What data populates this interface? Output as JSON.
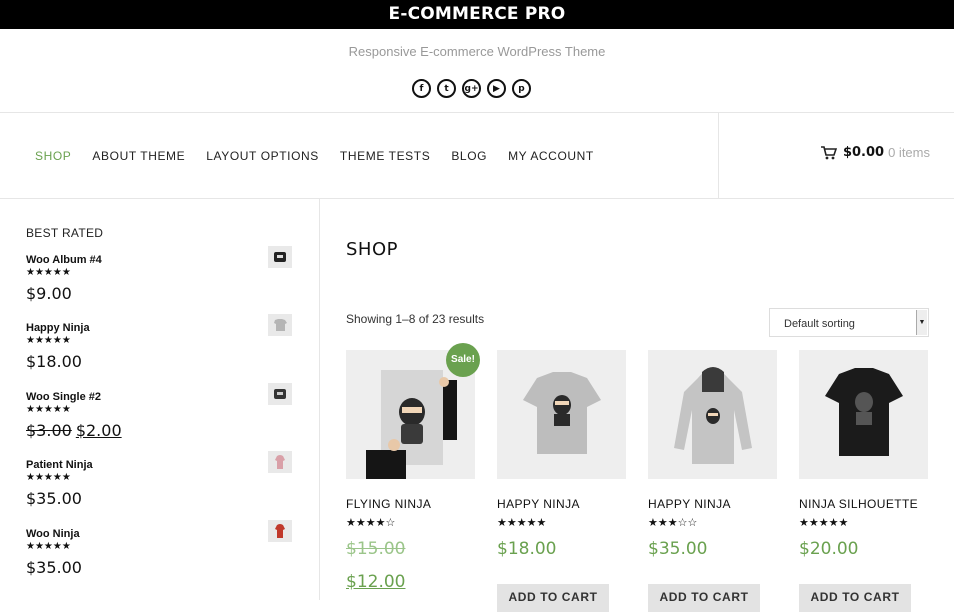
{
  "header": {
    "title": "E-COMMERCE PRO",
    "tagline": "Responsive E-commerce WordPress Theme",
    "socials": [
      {
        "name": "facebook-icon",
        "glyph": "f"
      },
      {
        "name": "twitter-icon",
        "glyph": "t"
      },
      {
        "name": "google-plus-icon",
        "glyph": "g+"
      },
      {
        "name": "youtube-icon",
        "glyph": "▶"
      },
      {
        "name": "pinterest-icon",
        "glyph": "p"
      }
    ]
  },
  "nav": {
    "items": [
      "SHOP",
      "ABOUT THEME",
      "LAYOUT OPTIONS",
      "THEME TESTS",
      "BLOG",
      "MY ACCOUNT"
    ],
    "active": "SHOP"
  },
  "cart": {
    "amount": "$0.00",
    "items": "0 items"
  },
  "sidebar": {
    "title": "BEST RATED",
    "items": [
      {
        "name": "Woo Album #4",
        "stars": "★★★★★",
        "price": "$9.00"
      },
      {
        "name": "Happy Ninja",
        "stars": "★★★★★",
        "price": "$18.00"
      },
      {
        "name": "Woo Single #2",
        "stars": "★★★★★",
        "old_price": "$3.00",
        "new_price": "$2.00"
      },
      {
        "name": "Patient Ninja",
        "stars": "★★★★★",
        "price": "$35.00"
      },
      {
        "name": "Woo Ninja",
        "stars": "★★★★★",
        "price": "$35.00"
      }
    ]
  },
  "main": {
    "heading": "SHOP",
    "showing": "Showing 1–8 of 23 results",
    "sort": "Default sorting",
    "sale_badge": "Sale!",
    "add_to_cart": "ADD TO CART",
    "products": [
      {
        "name": "FLYING NINJA",
        "stars": "★★★★☆",
        "price": "$15.00",
        "sale_price": "$12.00"
      },
      {
        "name": "HAPPY NINJA",
        "stars": "★★★★★",
        "price": "$18.00"
      },
      {
        "name": "HAPPY NINJA",
        "stars": "★★★☆☆",
        "price": "$35.00"
      },
      {
        "name": "NINJA SILHOUETTE",
        "stars": "★★★★★",
        "price": "$20.00"
      }
    ]
  },
  "colors": {
    "accent": "#6aa14f",
    "topbar": "#000000"
  }
}
